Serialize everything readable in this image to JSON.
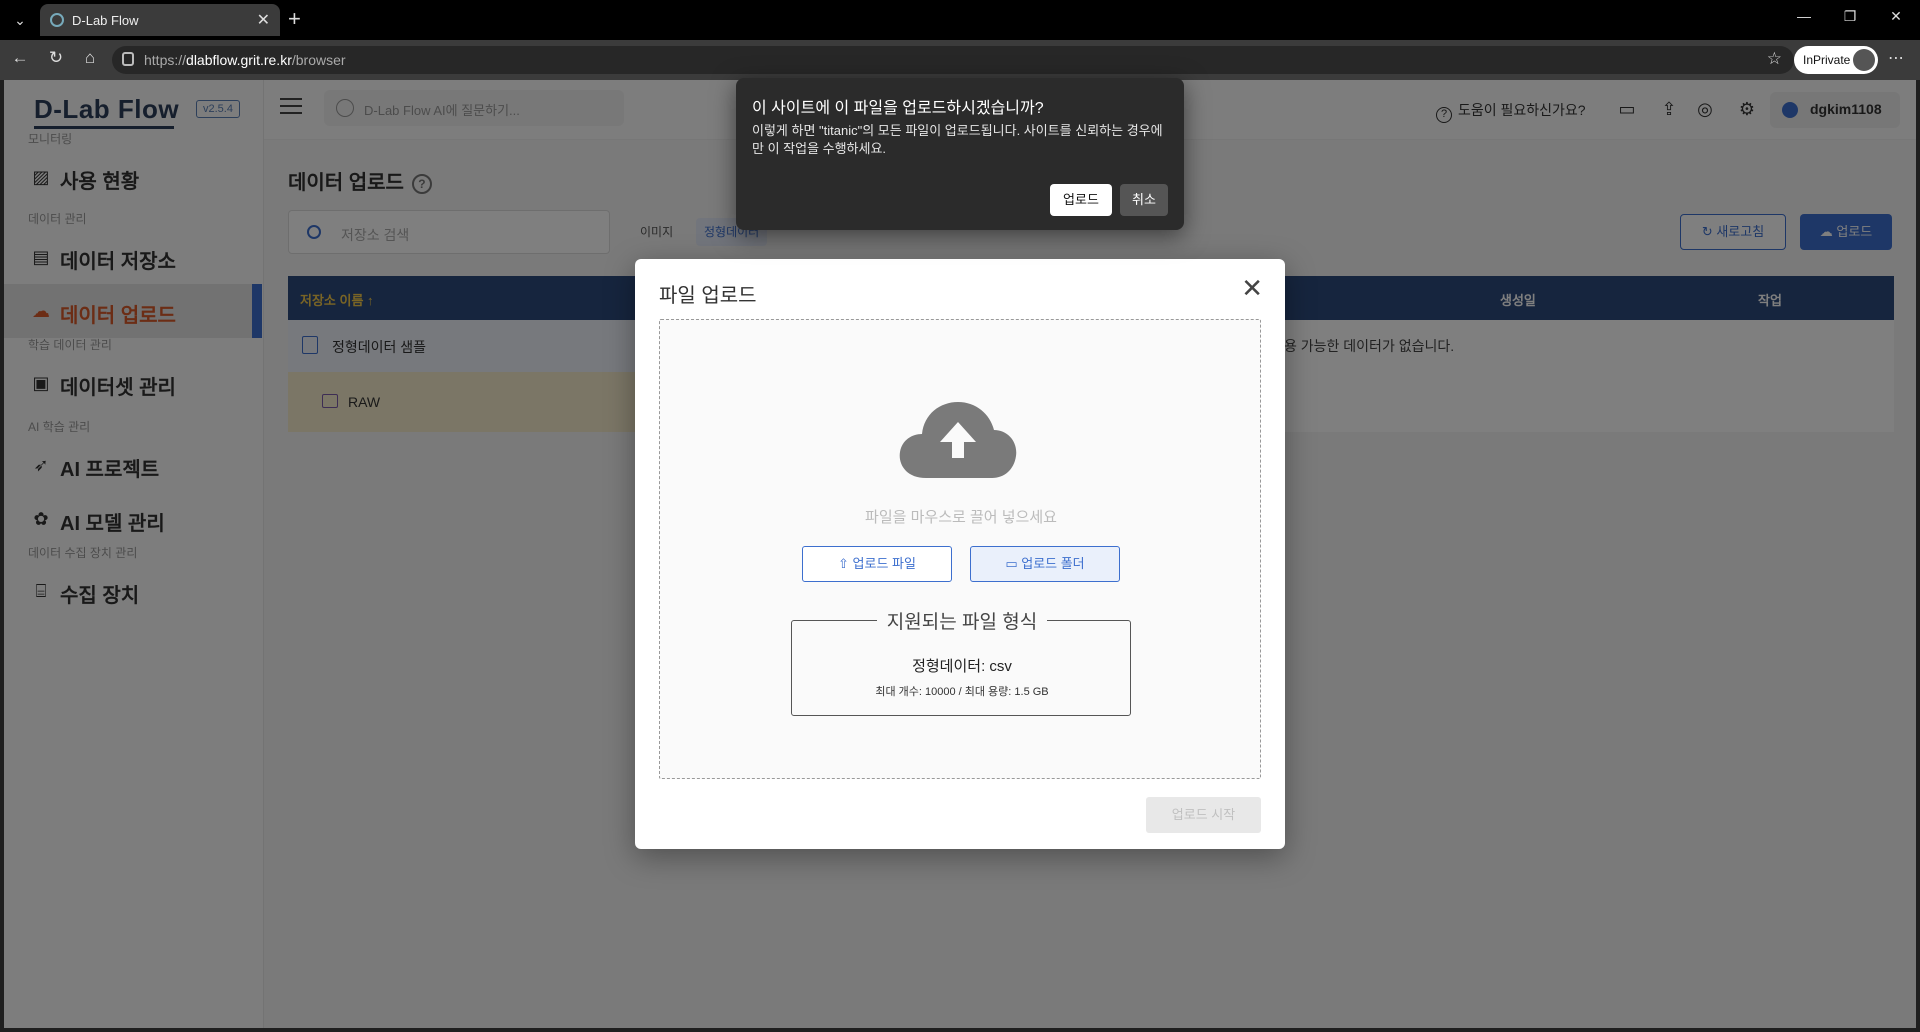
{
  "browser": {
    "tab_title": "D-Lab Flow",
    "url_prefix": "https://",
    "url_host": "dlabflow.grit.re.kr",
    "url_path": "/browser",
    "inprivate_label": "InPrivate"
  },
  "app": {
    "logo": "D-Lab Flow",
    "version": "v2.5.4",
    "ai_search_placeholder": "D-Lab Flow AI에 질문하기...",
    "help_label": "도움이 필요하신가요?",
    "username": "dgkim1108"
  },
  "sidebar": {
    "sections": [
      {
        "label": "모니터링"
      },
      {
        "label": "데이터 관리"
      },
      {
        "label": "학습 데이터 관리"
      },
      {
        "label": "AI 학습 관리"
      },
      {
        "label": "데이터 수집 장치 관리"
      }
    ],
    "items": [
      {
        "label": "사용 현황",
        "icon": "monitor-chart-icon"
      },
      {
        "label": "데이터 저장소",
        "icon": "storage-icon"
      },
      {
        "label": "데이터 업로드",
        "icon": "cloud-upload-icon"
      },
      {
        "label": "데이터셋 관리",
        "icon": "dataset-icon"
      },
      {
        "label": "AI 프로젝트",
        "icon": "rocket-icon"
      },
      {
        "label": "AI 모델 관리",
        "icon": "brain-icon"
      },
      {
        "label": "수집 장치",
        "icon": "device-icon"
      }
    ]
  },
  "main": {
    "title": "데이터 업로드",
    "search_placeholder": "저장소 검색",
    "filter_image": "이미지",
    "filter_structured": "정형데이터",
    "refresh_label": "새로고침",
    "upload_label": "업로드",
    "table": {
      "headers": [
        "저장소 이름 ↑",
        "생성일",
        "작업"
      ],
      "rows": [
        "정형데이터 샘플",
        "RAW"
      ],
      "empty_message": "용 가능한 데이터가 없습니다."
    }
  },
  "modal": {
    "title": "파일 업로드",
    "drop_hint": "파일을 마우스로 끌어 넣으세요",
    "btn_file": "업로드 파일",
    "btn_folder": "업로드 폴더",
    "formats_title": "지원되는 파일 형식",
    "formats_line": "정형데이터: csv",
    "formats_limit": "최대 개수: 10000 / 최대 용량: 1.5 GB",
    "start_label": "업로드 시작"
  },
  "confirm": {
    "title": "이 사이트에 이 파일을 업로드하시겠습니까?",
    "body": "이렇게 하면 \"titanic\"의 모든 파일이 업로드됩니다. 사이트를 신뢰하는 경우에만 이 작업을 수행하세요.",
    "upload_label": "업로드",
    "cancel_label": "취소"
  },
  "colors": {
    "primary": "#3d6fce",
    "active_text": "#d85a2a",
    "table_header": "#2d4b7c"
  }
}
